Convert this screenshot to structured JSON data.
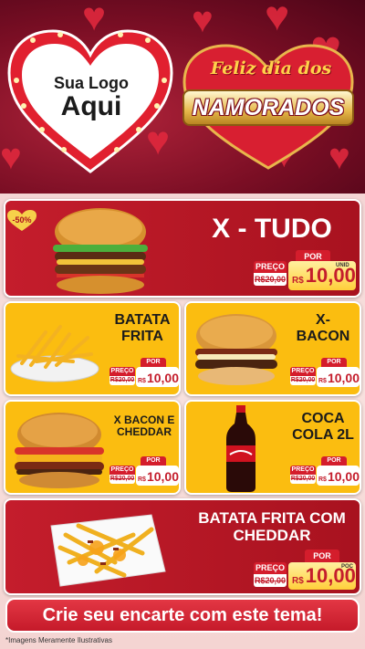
{
  "header": {
    "logo_line1": "Sua Logo",
    "logo_line2": "Aqui",
    "title_script": "Feliz dia dos",
    "title_ribbon": "NAMORADOS"
  },
  "badge": "-50%",
  "products": [
    {
      "name": "X - TUDO",
      "price_label": "PREÇO",
      "old_price": "R$20,00",
      "por_label": "POR",
      "currency": "R$",
      "price": "10,00",
      "unit": "UNID"
    },
    {
      "name_lines": [
        "BATATA",
        "FRITA"
      ],
      "price_label": "PREÇO",
      "old_price": "R$20,00",
      "por_label": "POR",
      "currency": "R$",
      "price": "10,00"
    },
    {
      "name_lines": [
        "X-",
        "BACON"
      ],
      "price_label": "PREÇO",
      "old_price": "R$20,00",
      "por_label": "POR",
      "currency": "R$",
      "price": "10,00"
    },
    {
      "name_lines": [
        "X BACON E",
        "CHEDDAR"
      ],
      "price_label": "PREÇO",
      "old_price": "R$20,00",
      "por_label": "POR",
      "currency": "R$",
      "price": "10,00"
    },
    {
      "name_lines": [
        "COCA",
        "COLA 2L"
      ],
      "price_label": "PREÇO",
      "old_price": "R$20,00",
      "por_label": "POR",
      "currency": "R$",
      "price": "10,00"
    },
    {
      "name_lines": [
        "BATATA FRITA COM",
        "CHEDDAR"
      ],
      "price_label": "PREÇO",
      "old_price": "R$20,00",
      "por_label": "POR",
      "currency": "R$",
      "price": "10,00",
      "unit": "POC"
    }
  ],
  "cta": "Crie seu encarte com este tema!",
  "footnote": "*Imagens Meramente Ilustrativas",
  "colors": {
    "red": "#c41d2c",
    "yellow": "#fbbd10",
    "gold": "#e6b84a"
  }
}
